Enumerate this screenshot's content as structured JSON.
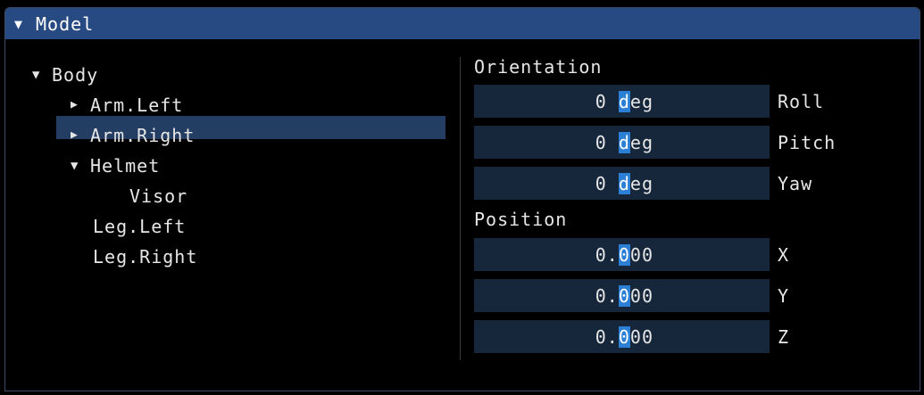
{
  "window": {
    "title": "Model"
  },
  "tree": {
    "items": [
      {
        "label": "Body",
        "toggle": "open"
      },
      {
        "label": "Arm.Left",
        "toggle": "closed"
      },
      {
        "label": "Arm.Right",
        "toggle": "closed",
        "selected": true
      },
      {
        "label": "Helmet",
        "toggle": "open"
      },
      {
        "label": "Visor",
        "toggle": "none"
      },
      {
        "label": "Leg.Left",
        "toggle": "none"
      },
      {
        "label": "Leg.Right",
        "toggle": "none"
      }
    ]
  },
  "orientation": {
    "label": "Orientation",
    "roll": {
      "value_pre": "0 ",
      "value_hl": "d",
      "value_post": "eg",
      "label": "Roll"
    },
    "pitch": {
      "value_pre": "0 ",
      "value_hl": "d",
      "value_post": "eg",
      "label": "Pitch"
    },
    "yaw": {
      "value_pre": "0 ",
      "value_hl": "d",
      "value_post": "eg",
      "label": "Yaw"
    }
  },
  "position": {
    "label": "Position",
    "x": {
      "value_pre": "0.",
      "value_hl": "0",
      "value_post": "00",
      "label": "X"
    },
    "y": {
      "value_pre": "0.",
      "value_hl": "0",
      "value_post": "00",
      "label": "Y"
    },
    "z": {
      "value_pre": "0.",
      "value_hl": "0",
      "value_post": "00",
      "label": "Z"
    }
  },
  "colors": {
    "titlebar": "#284a82",
    "selection": "#243e63",
    "field_bg": "#16263b",
    "cursor_highlight": "#2b7fd4"
  }
}
